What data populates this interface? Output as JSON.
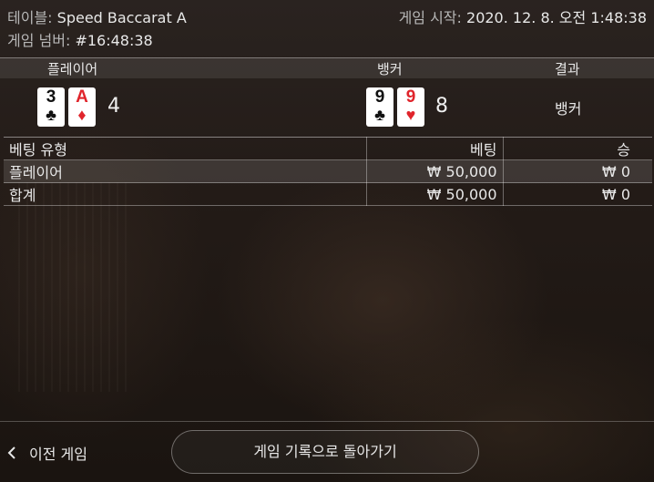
{
  "top": {
    "table_label": "테이블:",
    "table_name": "Speed Baccarat A",
    "game_no_label": "게임 넘버:",
    "game_no": "#16:48:38",
    "start_label": "게임 시작:",
    "start_time": "2020. 12. 8. 오전 1:48:38"
  },
  "result": {
    "headers": {
      "player": "플레이어",
      "banker": "뱅커",
      "outcome": "결과"
    },
    "player_cards": [
      {
        "rank": "3",
        "suit": "♣",
        "color": "black"
      },
      {
        "rank": "A",
        "suit": "♦",
        "color": "red"
      }
    ],
    "player_score": "4",
    "banker_cards": [
      {
        "rank": "9",
        "suit": "♣",
        "color": "black"
      },
      {
        "rank": "9",
        "suit": "♥",
        "color": "red"
      }
    ],
    "banker_score": "8",
    "winner": "뱅커"
  },
  "bets": {
    "headers": {
      "type": "베팅 유형",
      "bet": "베팅",
      "win": "승"
    },
    "rows": [
      {
        "type": "플레이어",
        "bet": "₩ 50,000",
        "win": "₩ 0"
      },
      {
        "type": "합계",
        "bet": "₩ 50,000",
        "win": "₩ 0"
      }
    ]
  },
  "footer": {
    "prev_label": "이전 게임",
    "back_label": "게임 기록으로 돌아가기"
  }
}
